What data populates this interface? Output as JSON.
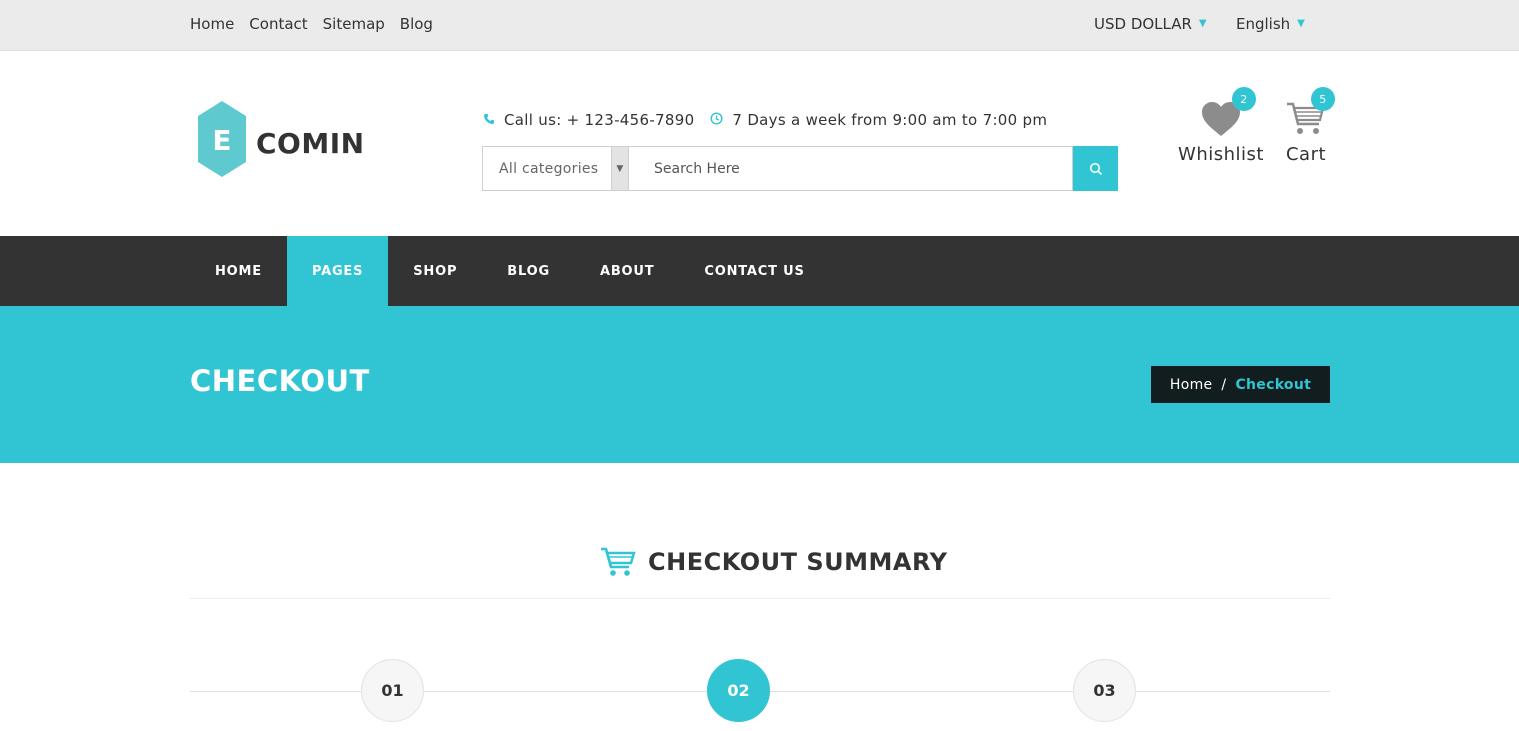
{
  "topbar": {
    "links": [
      "Home",
      "Contact",
      "Sitemap",
      "Blog"
    ],
    "currency": "USD DOLLAR",
    "language": "English"
  },
  "header": {
    "logo_letter": "E",
    "logo_text": "COMIN",
    "phone": "Call us: + 123-456-7890",
    "hours": "7 Days a week from 9:00 am to 7:00 pm",
    "search": {
      "category": "All categories",
      "placeholder": "Search Here"
    },
    "wishlist": {
      "label": "Whishlist",
      "count": "2"
    },
    "cart": {
      "label": "Cart",
      "count": "5"
    }
  },
  "nav": {
    "items": [
      "HOME",
      "PAGES",
      "SHOP",
      "BLOG",
      "ABOUT",
      "CONTACT US"
    ],
    "active": "PAGES"
  },
  "banner": {
    "title": "CHECKOUT",
    "breadcrumb": {
      "home": "Home",
      "separator": "/",
      "current": "Checkout"
    }
  },
  "summary": {
    "title": "CHECKOUT SUMMARY",
    "steps": [
      "01",
      "02",
      "03"
    ],
    "active_step": "02"
  },
  "colors": {
    "accent": "#31c5d3",
    "nav_bg": "#333333",
    "topbar_bg": "#ebebeb",
    "breadcrumb_bg": "#111d1f"
  },
  "icons": {
    "phone": "phone-icon",
    "clock": "clock-icon",
    "search": "search-icon",
    "wishlist": "heart-icon",
    "cart": "cart-icon",
    "summary": "cart-icon"
  }
}
